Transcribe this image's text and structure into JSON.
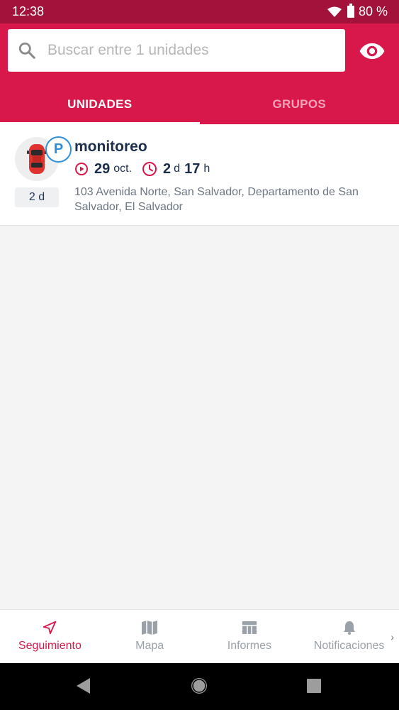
{
  "status_bar": {
    "time": "12:38",
    "battery": "80 %"
  },
  "search": {
    "placeholder": "Buscar entre 1 unidades"
  },
  "tabs": [
    {
      "label": "UNIDADES"
    },
    {
      "label": "GRUPOS"
    }
  ],
  "unit": {
    "name": "monitoreo",
    "badge": "P",
    "age": "2 d",
    "date_day": "29",
    "date_month": "oct.",
    "dur_days": "2",
    "dur_days_unit": "d",
    "dur_hours": "17",
    "dur_hours_unit": "h",
    "address": "103 Avenida Norte, San Salvador, Departamento de San Salvador, El Salvador"
  },
  "nav": [
    {
      "label": "Seguimiento",
      "icon": "navigation-arrow-icon"
    },
    {
      "label": "Mapa",
      "icon": "map-icon"
    },
    {
      "label": "Informes",
      "icon": "table-icon"
    },
    {
      "label": "Notificaciones",
      "icon": "bell-icon"
    }
  ],
  "colors": {
    "accent": "#d8174a",
    "status_bar": "#a3123a",
    "parking_blue": "#2f8fd8"
  }
}
